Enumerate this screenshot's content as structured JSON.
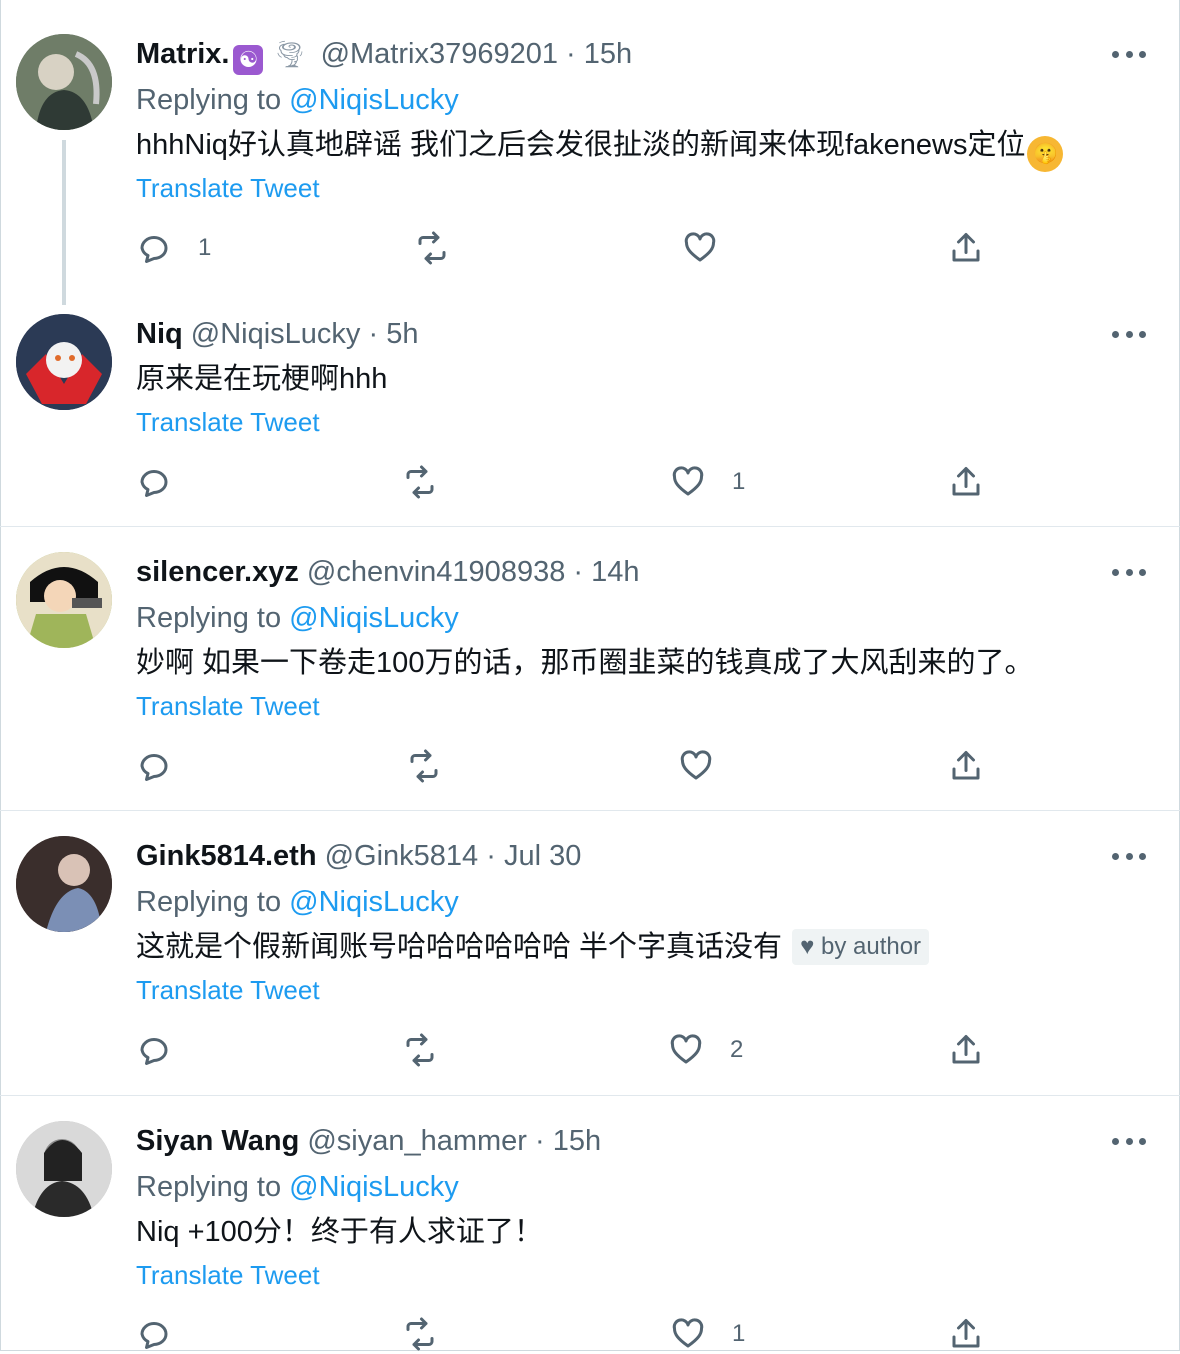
{
  "tweets": [
    {
      "name": "Matrix.",
      "badge_emoji": "☯",
      "extra_emoji": "🌪",
      "handle": "@Matrix37969201",
      "time": "· 15h",
      "reply_prefix": "Replying to",
      "reply_handle": "@NiqisLucky",
      "text": "hhhNiq好认真地辟谣 我们之后会发很扯淡的新闻来体现fakenews定位",
      "trailing_emoji": "🤫",
      "translate": "Translate Tweet",
      "reply_count": "1",
      "like_count": "",
      "avatar_color": "#5d6b5a"
    },
    {
      "name": "Niq",
      "handle": "@NiqisLucky",
      "time": "· 5h",
      "text": "原来是在玩梗啊hhh",
      "translate": "Translate Tweet",
      "reply_count": "",
      "like_count": "1",
      "avatar_color": "#2b3a55"
    },
    {
      "name": "silencer.xyz",
      "handle": "@chenvin41908938",
      "time": "· 14h",
      "reply_prefix": "Replying to",
      "reply_handle": "@NiqisLucky",
      "text": "妙啊 如果一下卷走100万的话，那币圈韭菜的钱真成了大风刮来的了。",
      "translate": "Translate Tweet",
      "reply_count": "",
      "like_count": "",
      "avatar_color": "#9fb55a"
    },
    {
      "name": "Gink5814.eth",
      "handle": "@Gink5814",
      "time": "· Jul 30",
      "reply_prefix": "Replying to",
      "reply_handle": "@NiqisLucky",
      "text": "这就是个假新闻账号哈哈哈哈哈哈 半个字真话没有",
      "by_author": "by author",
      "translate": "Translate Tweet",
      "reply_count": "",
      "like_count": "2",
      "avatar_color": "#4a3c3a"
    },
    {
      "name": "Siyan Wang",
      "handle": "@siyan_hammer",
      "time": "· 15h",
      "reply_prefix": "Replying to",
      "reply_handle": "@NiqisLucky",
      "text": "Niq +100分！终于有人求证了！",
      "translate": "Translate Tweet",
      "reply_count": "",
      "like_count": "1",
      "avatar_color": "#b8b8b8"
    }
  ],
  "colors": {
    "link": "#1d9bf0",
    "secondary": "#536471",
    "divider": "#e1e8ed"
  },
  "icons": [
    "reply-icon",
    "retweet-icon",
    "like-icon",
    "share-icon",
    "more-icon",
    "heart-icon"
  ]
}
